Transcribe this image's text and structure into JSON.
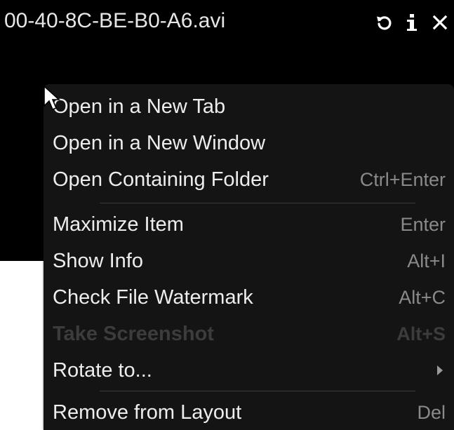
{
  "tile": {
    "title": "00-40-8C-BE-B0-A6.avi",
    "buttons": [
      {
        "icon": "rotate-icon"
      },
      {
        "icon": "info-icon"
      },
      {
        "icon": "close-icon"
      }
    ]
  },
  "menu": {
    "items": [
      {
        "label": "Open in a New Tab",
        "shortcut": ""
      },
      {
        "label": "Open in a New Window",
        "shortcut": ""
      },
      {
        "label": "Open Containing Folder",
        "shortcut": "Ctrl+Enter"
      },
      {
        "label": "Maximize Item",
        "shortcut": "Enter"
      },
      {
        "label": "Show Info",
        "shortcut": "Alt+I"
      },
      {
        "label": "Check File Watermark",
        "shortcut": "Alt+C"
      },
      {
        "label": "Take Screenshot",
        "shortcut": "Alt+S",
        "disabled": true
      },
      {
        "label": "Rotate to...",
        "shortcut": "",
        "submenu": true
      },
      {
        "label": "Remove from Layout",
        "shortcut": "Del"
      }
    ]
  },
  "colors": {
    "tile_background": "#000000",
    "menu_background": "#141414",
    "menu_text": "#ededed",
    "shortcut_text": "#8a8a8a",
    "disabled_text": "#3c3c3c"
  }
}
